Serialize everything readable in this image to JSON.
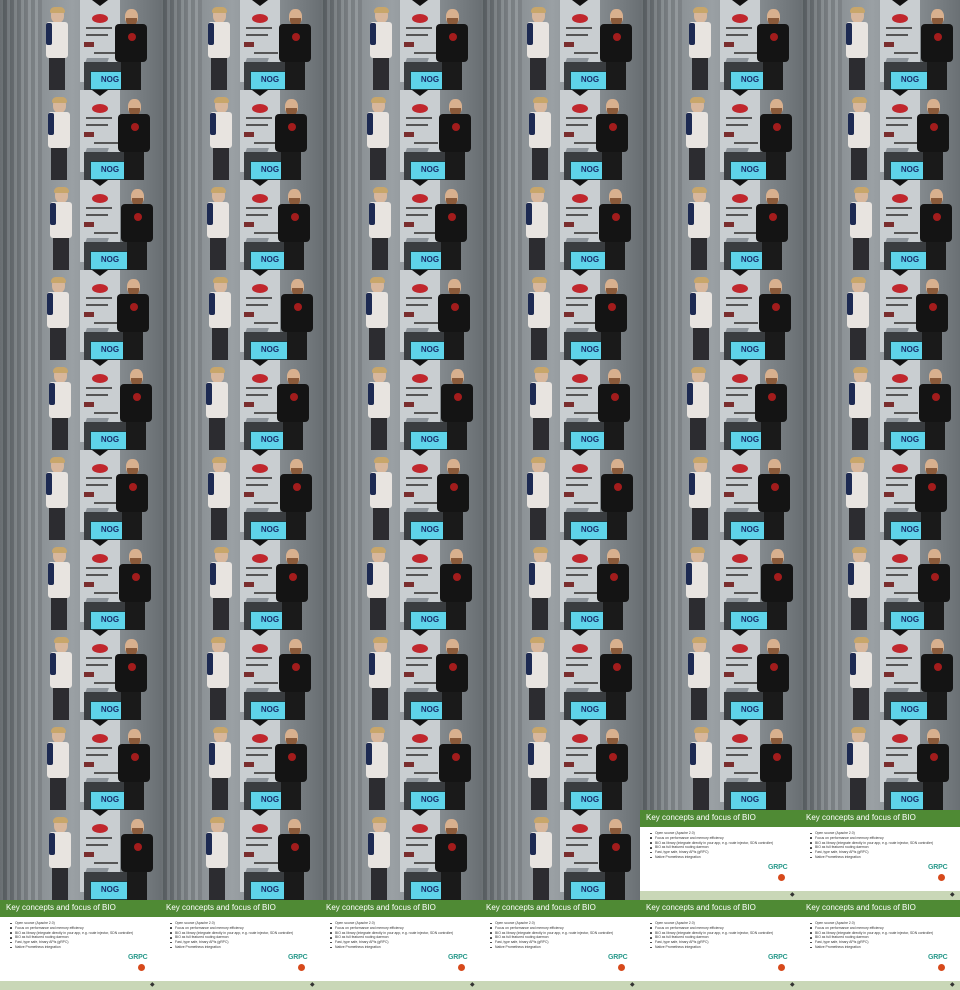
{
  "grid": {
    "columns": 6,
    "rows": 11,
    "frame_count": 62,
    "slide_count": 8
  },
  "video_frame": {
    "screen_text": "NOG",
    "colors": {
      "slide_header": "#4f8a34",
      "screen": "#5ed4ea",
      "emblem": "#a31c1c"
    }
  },
  "slide": {
    "title": "Key concepts and focus of BIO",
    "bullets": [
      "Open source (Apache 2.0)",
      "Focus on performance and memory efficiency",
      "BIO as library (integrate directly in your app, e.g. route injector, SDN controller)",
      "BIO as full featured routing daemon",
      "Fast, type safe, binary APIs (gRPC)",
      "Native Prometheus integration"
    ],
    "logo_text": "GRPC"
  },
  "tiles": [
    "frame",
    "frame",
    "frame",
    "frame",
    "frame",
    "frame",
    "frame",
    "frame",
    "frame",
    "frame",
    "frame",
    "frame",
    "frame",
    "frame",
    "frame",
    "frame",
    "frame",
    "frame",
    "frame",
    "frame",
    "frame",
    "frame",
    "frame",
    "frame",
    "frame",
    "frame",
    "frame",
    "frame",
    "frame",
    "frame",
    "frame",
    "frame",
    "frame",
    "frame",
    "frame",
    "frame",
    "frame",
    "frame",
    "frame",
    "frame",
    "frame",
    "frame",
    "frame",
    "frame",
    "frame",
    "frame",
    "frame",
    "frame",
    "frame",
    "frame",
    "frame",
    "frame",
    "frame",
    "frame",
    "frame",
    "frame",
    "frame",
    "frame",
    "slide",
    "slide",
    "slide",
    "slide",
    "slide",
    "slide",
    "slide",
    "slide"
  ]
}
